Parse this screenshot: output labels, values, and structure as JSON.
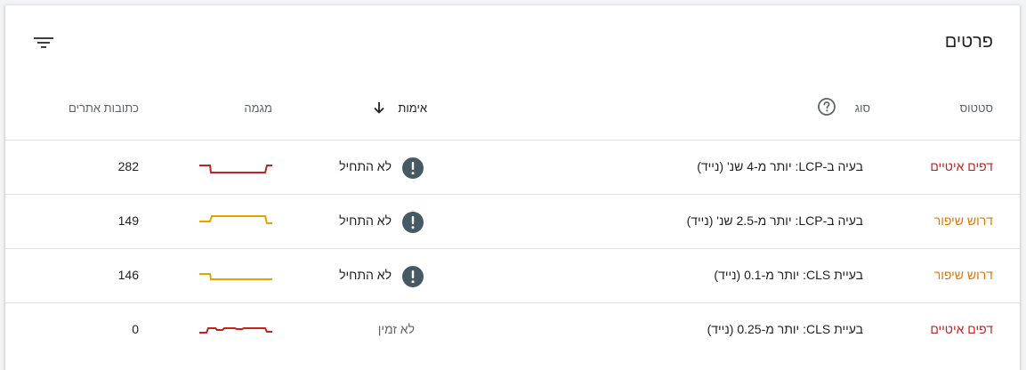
{
  "card": {
    "title": "פרטים"
  },
  "icons": {
    "filter": "filter-list-icon",
    "help": "help-circle-icon",
    "sort": "arrow-down-icon",
    "warning": "exclamation-circle-icon"
  },
  "headers": {
    "status": "סטטוס",
    "type": "סוג",
    "validation": "אימות",
    "trend": "מגמה",
    "urls": "כתובות אתרים"
  },
  "colors": {
    "poor": "#c5221f",
    "needs_improvement": "#e37400",
    "warning_icon": "#455a64"
  },
  "rows": [
    {
      "status": "דפים איטיים",
      "status_level": "poor",
      "type": "בעיה ב-LCP: יותר מ-4 שנ' (נייד)",
      "validation": "לא התחיל",
      "has_warning": true,
      "urls": "282"
    },
    {
      "status": "דרוש שיפור",
      "status_level": "needs_improvement",
      "type": "בעיה ב-LCP: יותר מ-2.5 שנ' (נייד)",
      "validation": "לא התחיל",
      "has_warning": true,
      "urls": "149"
    },
    {
      "status": "דרוש שיפור",
      "status_level": "needs_improvement",
      "type": "בעיית CLS: יותר מ-0.1 (נייד)",
      "validation": "לא התחיל",
      "has_warning": true,
      "urls": "146"
    },
    {
      "status": "דפים איטיים",
      "status_level": "poor",
      "type": "בעיית CLS: יותר מ-0.25 (נייד)",
      "validation": "לא זמין",
      "has_warning": false,
      "urls": "0"
    }
  ]
}
